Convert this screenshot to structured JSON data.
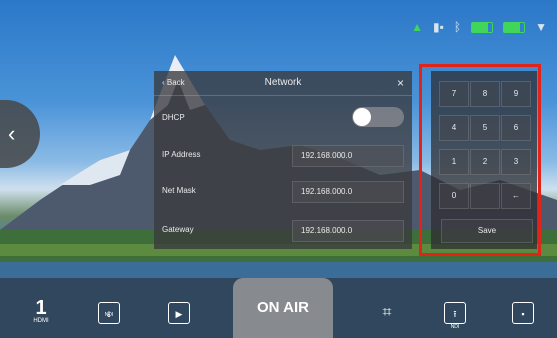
{
  "status_bar": {
    "icons": [
      "android-icon",
      "card-icon",
      "bluetooth-icon",
      "battery-icon",
      "battery-icon",
      "wifi-icon"
    ]
  },
  "network_panel": {
    "back_label": "Back",
    "title": "Network",
    "close_symbol": "×",
    "fields": [
      {
        "label": "DHCP",
        "type": "toggle",
        "value": "off"
      },
      {
        "label": "IP Address",
        "value": "192.168.000.0"
      },
      {
        "label": "Net Mask",
        "value": "192.168.000.0"
      },
      {
        "label": "Gateway",
        "value": "192.168.000.0"
      }
    ]
  },
  "keypad": {
    "keys": [
      "7",
      "8",
      "9",
      "4",
      "5",
      "6",
      "1",
      "2",
      "3",
      "0",
      "",
      ""
    ],
    "backspace_symbol": "←",
    "save_label": "Save"
  },
  "bottom_bar": {
    "hdmi_number": "1",
    "hdmi_label": "HDMI",
    "on_air_label": "ON AIR",
    "ndi_in_label": "NDI",
    "ndi_out_label": "NDI"
  },
  "colors": {
    "highlight": "#e2231a",
    "status_green": "#3fd65a"
  }
}
